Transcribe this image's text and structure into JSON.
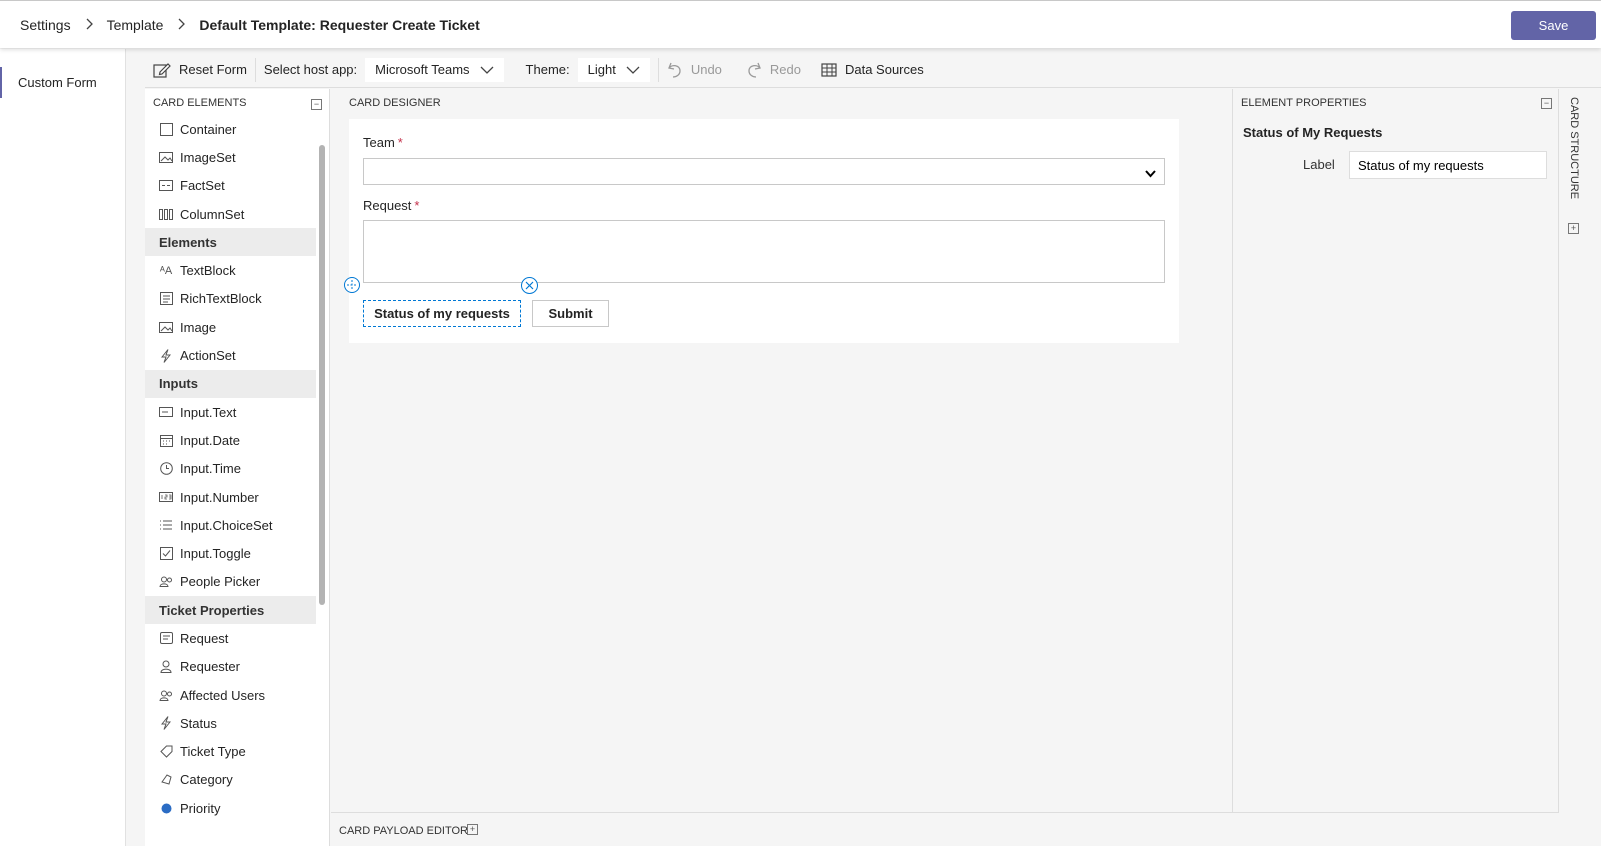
{
  "breadcrumb": {
    "items": [
      "Settings",
      "Template"
    ],
    "current": "Default Template: Requester Create Ticket"
  },
  "header": {
    "save_label": "Save"
  },
  "leftnav": {
    "items": [
      {
        "label": "Custom Form"
      }
    ]
  },
  "toolbar": {
    "reset_label": "Reset Form",
    "host_app_label": "Select host app:",
    "host_app_value": "Microsoft Teams",
    "theme_label": "Theme:",
    "theme_value": "Light",
    "undo_label": "Undo",
    "redo_label": "Redo",
    "data_sources_label": "Data Sources"
  },
  "card_elements": {
    "title": "CARD ELEMENTS",
    "containers": [
      {
        "label": "Container",
        "icon": "container-icon"
      },
      {
        "label": "ImageSet",
        "icon": "imageset-icon"
      },
      {
        "label": "FactSet",
        "icon": "factset-icon"
      },
      {
        "label": "ColumnSet",
        "icon": "columnset-icon"
      }
    ],
    "elements_header": "Elements",
    "elements": [
      {
        "label": "TextBlock",
        "icon": "textblock-icon"
      },
      {
        "label": "RichTextBlock",
        "icon": "richtextblock-icon"
      },
      {
        "label": "Image",
        "icon": "image-icon"
      },
      {
        "label": "ActionSet",
        "icon": "actionset-icon"
      }
    ],
    "inputs_header": "Inputs",
    "inputs": [
      {
        "label": "Input.Text",
        "icon": "input-text-icon"
      },
      {
        "label": "Input.Date",
        "icon": "calendar-icon"
      },
      {
        "label": "Input.Time",
        "icon": "clock-icon"
      },
      {
        "label": "Input.Number",
        "icon": "number-icon"
      },
      {
        "label": "Input.ChoiceSet",
        "icon": "list-icon"
      },
      {
        "label": "Input.Toggle",
        "icon": "checkbox-icon"
      },
      {
        "label": "People Picker",
        "icon": "people-icon"
      }
    ],
    "ticket_header": "Ticket Properties",
    "ticket": [
      {
        "label": "Request",
        "icon": "request-icon"
      },
      {
        "label": "Requester",
        "icon": "person-icon"
      },
      {
        "label": "Affected Users",
        "icon": "people-icon"
      },
      {
        "label": "Status",
        "icon": "status-icon"
      },
      {
        "label": "Ticket Type",
        "icon": "tag-icon"
      },
      {
        "label": "Category",
        "icon": "category-icon"
      },
      {
        "label": "Priority",
        "icon": "priority-dot-icon"
      }
    ]
  },
  "designer": {
    "title": "CARD DESIGNER",
    "team_label": "Team",
    "request_label": "Request",
    "required_marker": "*",
    "actions": [
      {
        "label": "Status of my requests"
      },
      {
        "label": "Submit"
      }
    ]
  },
  "payload_editor": {
    "title": "CARD PAYLOAD EDITOR"
  },
  "properties": {
    "title": "ELEMENT PROPERTIES",
    "element_title": "Status of My Requests",
    "label_name": "Label",
    "label_value": "Status of my requests"
  },
  "structure": {
    "title": "CARD STRUCTURE"
  },
  "colors": {
    "accent": "#6264a7",
    "selection": "#0078d4",
    "required": "#c4314b"
  }
}
